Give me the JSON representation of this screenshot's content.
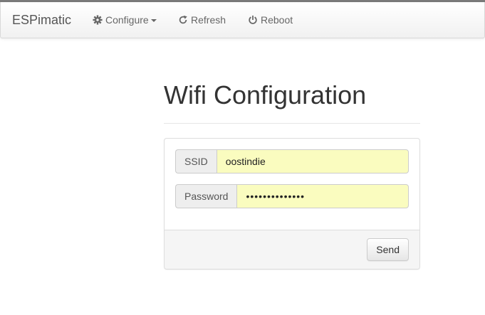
{
  "navbar": {
    "brand": "ESPimatic",
    "items": [
      {
        "label": "Configure",
        "icon": "gear-icon",
        "has_dropdown": true
      },
      {
        "label": "Refresh",
        "icon": "refresh-icon",
        "has_dropdown": false
      },
      {
        "label": "Reboot",
        "icon": "power-icon",
        "has_dropdown": false
      }
    ]
  },
  "page": {
    "title": "Wifi Configuration"
  },
  "form": {
    "ssid_label": "SSID",
    "ssid_value": "oostindie",
    "password_label": "Password",
    "password_value": "••••••••••••••",
    "send_label": "Send"
  },
  "colors": {
    "autofill_background": "#fafcbf",
    "navbar_text": "#666666",
    "top_border": "#7a7a7a"
  }
}
